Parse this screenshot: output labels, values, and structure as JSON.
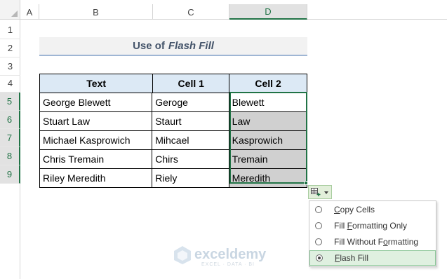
{
  "columns": [
    "A",
    "B",
    "C",
    "D"
  ],
  "rows": [
    "1",
    "2",
    "3",
    "4",
    "5",
    "6",
    "7",
    "8",
    "9"
  ],
  "title": {
    "prefix": "Use of",
    "italic": "Flash Fill"
  },
  "table": {
    "headers": [
      "Text",
      "Cell 1",
      "Cell 2"
    ],
    "rows": [
      [
        "George Blewett",
        "Geroge",
        "Blewett"
      ],
      [
        "Stuart Law",
        "Staurt",
        "Law"
      ],
      [
        "Michael Kasprowich",
        "Mihcael",
        "Kasprowich"
      ],
      [
        "Chris Tremain",
        "Chirs",
        "Tremain"
      ],
      [
        "Riley Meredith",
        "Riely",
        "Meredith"
      ]
    ]
  },
  "autofill_menu": {
    "items": [
      {
        "mnemonic": "C",
        "rest": "opy Cells",
        "checked": false
      },
      {
        "pre": "Fill ",
        "mnemonic": "F",
        "rest": "ormatting Only",
        "checked": false
      },
      {
        "pre": "Fill Without F",
        "mnemonic": "o",
        "rest": "rmatting",
        "checked": false
      },
      {
        "mnemonic": "F",
        "rest": "lash Fill",
        "checked": true
      }
    ]
  },
  "watermark": {
    "name": "exceldemy",
    "tagline": "EXCEL · DATA · BI"
  },
  "colors": {
    "accent": "#217346",
    "header_fill": "#dce9f5",
    "flash_fill_gray": "#d0d0d0"
  }
}
